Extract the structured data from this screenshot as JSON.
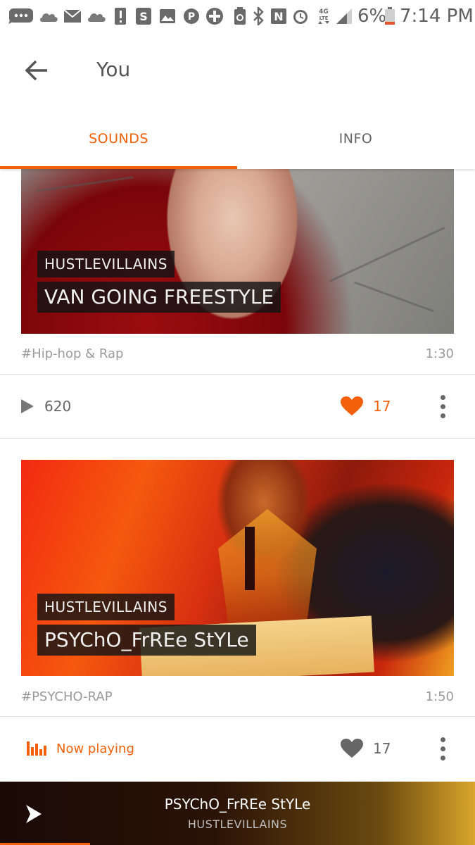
{
  "status_bar": {
    "battery": "6%",
    "time": "7:14 PM",
    "icons": [
      "messages-icon",
      "cloud-icon",
      "mail-icon",
      "cloud-icon",
      "alert-icon",
      "s-app-icon",
      "gallery-icon",
      "pandora-icon",
      "plus-app-icon",
      "battery-saver-icon",
      "bluetooth-icon",
      "nfc-icon",
      "alarm-icon",
      "lte-icon",
      "signal-icon",
      "battery-icon"
    ]
  },
  "header": {
    "title": "You",
    "back_icon": "arrow-back-icon"
  },
  "tabs": [
    {
      "label": "SOUNDS",
      "active": true
    },
    {
      "label": "INFO",
      "active": false
    }
  ],
  "tracks": [
    {
      "user": "HUSTLEVILLAINS",
      "title": "VAN GOING FREESTYLE",
      "genre": "#Hip-hop & Rap",
      "duration": "1:30",
      "plays": "620",
      "likes": "17",
      "liked": true,
      "now_playing": false
    },
    {
      "user": "HUSTLEVILLAINS",
      "title": "PSYChO_FrREe StYLe",
      "genre": "#PSYCHO-RAP",
      "duration": "1:50",
      "likes": "17",
      "liked": false,
      "now_playing": true,
      "now_playing_label": "Now playing"
    }
  ],
  "mini_player": {
    "title": "PSYChO_FrREe StYLe",
    "user": "HUSTLEVILLAINS",
    "progress": 0.19
  },
  "colors": {
    "accent": "#f2600a",
    "text_secondary": "#9a9a9a"
  }
}
